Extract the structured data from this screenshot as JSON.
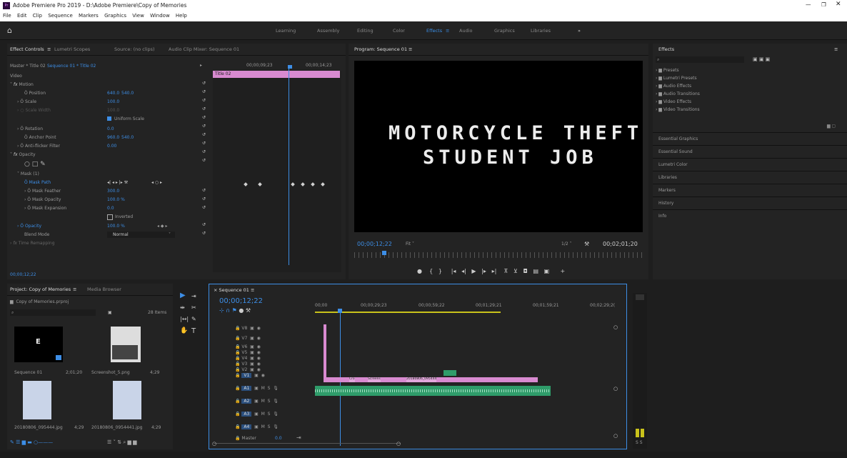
{
  "window": {
    "title": "Adobe Premiere Pro 2019 - D:\\Adobe Premiere\\Copy of Memories",
    "menu": [
      "File",
      "Edit",
      "Clip",
      "Sequence",
      "Markers",
      "Graphics",
      "View",
      "Window",
      "Help"
    ]
  },
  "workspaces": [
    "Learning",
    "Assembly",
    "Editing",
    "Color",
    "Effects",
    "Audio",
    "Graphics",
    "Libraries",
    "»"
  ],
  "effect_controls": {
    "tabs": [
      "Effect Controls",
      "Lumetri Scopes",
      "Source: (no clips)",
      "Audio Clip Mixer: Sequence 01"
    ],
    "master_label": "Master * Title 02",
    "seq_label": "Sequence 01 * Title 02",
    "section": "Video",
    "motion": "Motion",
    "rows": [
      {
        "label": "Position",
        "v1": "640.0",
        "v2": "540.0"
      },
      {
        "label": "Scale",
        "v1": "100.0",
        "v2": ""
      },
      {
        "label": "Scale Width",
        "v1": "100.0",
        "v2": ""
      },
      {
        "label": "",
        "v1": "Uniform Scale",
        "v2": ""
      },
      {
        "label": "Rotation",
        "v1": "0.0",
        "v2": ""
      },
      {
        "label": "Anchor Point",
        "v1": "960.0",
        "v2": "540.0"
      },
      {
        "label": "Anti-flicker Filter",
        "v1": "0.00",
        "v2": ""
      }
    ],
    "opacity": "Opacity",
    "mask": "Mask (1)",
    "mask_rows": [
      {
        "label": "Mask Path",
        "v1": ""
      },
      {
        "label": "Mask Feather",
        "v1": "300.0"
      },
      {
        "label": "Mask Opacity",
        "v1": "100.0 %"
      },
      {
        "label": "Mask Expansion",
        "v1": "0.0"
      },
      {
        "label": "",
        "v1": "Inverted"
      },
      {
        "label": "Opacity",
        "v1": "100.0 %"
      },
      {
        "label": "Blend Mode",
        "v1": "Normal"
      }
    ],
    "time_remap": "Time Remapping",
    "ruler_a": "00;00;09;23",
    "ruler_b": "00;00;14;23",
    "clip_label": "Title 02",
    "timecode": "00;00;12;22"
  },
  "program": {
    "tab": "Program: Sequence 01",
    "line1": "MOTORCYCLE THEFT",
    "line2": "STUDENT JOB",
    "timecode": "00;00;12;22",
    "fit": "Fit",
    "res": "1/2",
    "duration": "00;02;01;20"
  },
  "effects_panel": {
    "title": "Effects",
    "tree": [
      "Presets",
      "Lumetri Presets",
      "Audio Effects",
      "Audio Transitions",
      "Video Effects",
      "Video Transitions"
    ],
    "collapsed": [
      "Essential Graphics",
      "Essential Sound",
      "Lumetri Color",
      "Libraries",
      "Markers",
      "History",
      "Info"
    ]
  },
  "project": {
    "tabs": [
      "Project: Copy of Memories",
      "Media Browser"
    ],
    "file": "Copy of Memories.prproj",
    "count": "28 Items",
    "items": [
      {
        "name": "Sequence 01",
        "dur": "2;01;20"
      },
      {
        "name": "Screenshot_5.png",
        "dur": "4;29"
      },
      {
        "name": "20180806_095444.jpg",
        "dur": "4;29"
      },
      {
        "name": "20180806_0954441.jpg",
        "dur": "4;29"
      }
    ],
    "thumb_letter": "E"
  },
  "timeline": {
    "tab": "Sequence 01",
    "timecode": "00;00;12;22",
    "ruler": [
      "00;00",
      "00;00;29;23",
      "00;00;59;22",
      "00;01;29;21",
      "00;01;59;21",
      "00;02;29;2("
    ],
    "video_tracks": [
      "V8",
      "V7",
      "V6",
      "V5",
      "V4",
      "V3",
      "V2",
      "V1"
    ],
    "audio_tracks": [
      "A1",
      "A2",
      "A3",
      "A4"
    ],
    "master": "Master",
    "master_val": "0.0",
    "clip_labels": [
      "Cro",
      "Screens",
      "20180806_095444",
      "20180806_095444"
    ]
  },
  "meter": {
    "label": "S S"
  },
  "colors": {
    "accent": "#3d8ee6",
    "clip_pink": "#d88ad0",
    "audio_green": "#2f9c6a",
    "ws_active": "#3b8fe8"
  }
}
